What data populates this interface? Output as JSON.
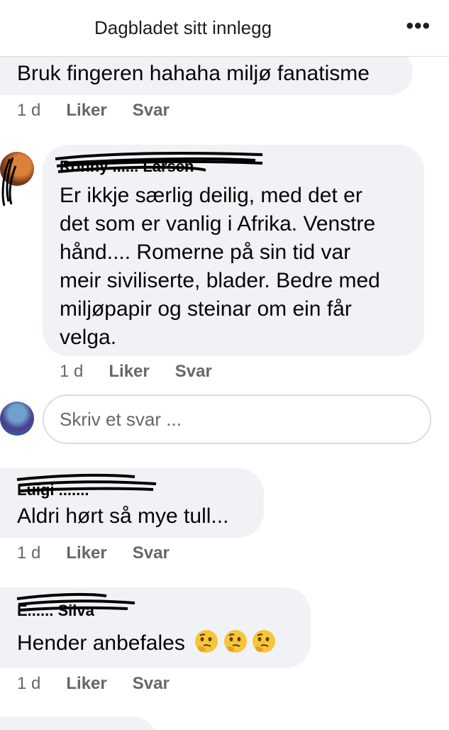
{
  "header": {
    "title": "Dagbladet sitt innlegg",
    "more_icon": "more-dots-icon"
  },
  "comments": [
    {
      "text": "Bruk fingeren hahaha miljø fanatisme",
      "time": "1 d",
      "like": "Liker",
      "reply": "Svar"
    },
    {
      "name": "Ronny ...... Larsen",
      "text_lines": [
        "Er ikkje særlig deilig, med det er",
        "det som er vanlig i Afrika. Venstre",
        "hånd.... Romerne på sin tid var",
        "meir siviliserte, blader. Bedre med",
        "miljøpapir og steinar om ein får",
        "velga."
      ],
      "time": "1 d",
      "like": "Liker",
      "reply": "Svar"
    },
    {
      "name": "Luigi .......",
      "text": "Aldri hørt så mye tull...",
      "time": "1 d",
      "like": "Liker",
      "reply": "Svar"
    },
    {
      "name": "E...... Silva",
      "text": "Hender anbefales",
      "emoji": "thinking-face-icon",
      "time": "1 d",
      "like": "Liker",
      "reply": "Svar"
    }
  ],
  "reply_box": {
    "placeholder": "Skriv et svar ..."
  }
}
